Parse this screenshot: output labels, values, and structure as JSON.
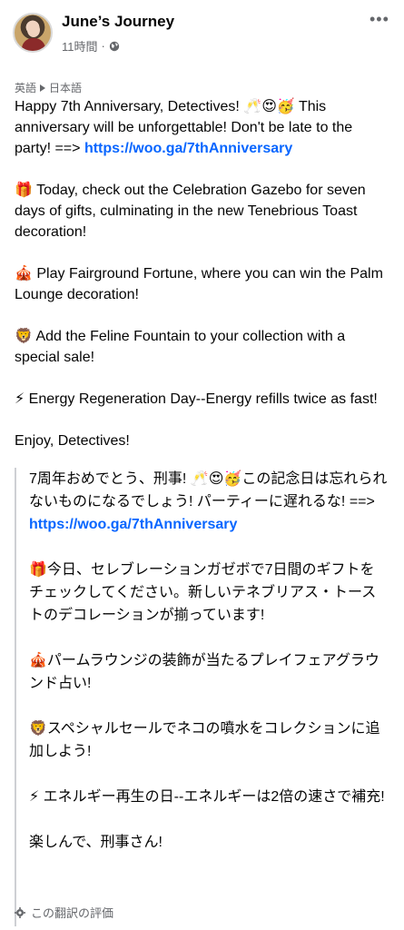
{
  "header": {
    "page_name": "June’s Journey",
    "time": "11時間",
    "separator": "·"
  },
  "language": {
    "source": "英語",
    "target": "日本語"
  },
  "post": {
    "p1_text": "Happy 7th Anniversary, Detectives! 🥂😍🥳 This anniversary will be unforgettable! Don't be late to the party! ==> ",
    "p1_link": "https://woo.ga/7thAnniversary",
    "p2": "🎁 Today, check out the Celebration Gazebo for seven days of gifts, culminating in the new Tenebrious Toast decoration!",
    "p3": "🎪 Play Fairground Fortune, where you can win the Palm Lounge decoration!",
    "p4": "🦁 Add the Feline Fountain to your collection with a special sale!",
    "p5": "⚡ Energy Regeneration Day--Energy refills twice as fast!",
    "p6": "Enjoy, Detectives!"
  },
  "translation": {
    "p1_text": "7周年おめでとう、刑事! 🥂😍🥳この記念日は忘れられないものになるでしょう! パーティーに遅れるな! ==> ",
    "p1_link": "https://woo.ga/7thAnniversary",
    "p2": "🎁今日、セレブレーションガゼボで7日間のギフトをチェックしてください。新しいテネブリアス・トーストのデコレーションが揃っています!",
    "p3": "🎪パームラウンジの装飾が当たるプレイフェアグラウンド占い!",
    "p4": "🦁スペシャルセールでネコの噴水をコレクションに追加しよう!",
    "p5": "⚡ エネルギー再生の日--エネルギーは2倍の速さで補充!",
    "p6": "楽しんで、刑事さん!",
    "rate_label": "この翻訳の評価"
  },
  "icons": {
    "avatar": "avatar-image",
    "audience": "globe-icon",
    "more": "more-icon",
    "rate": "gear-icon"
  }
}
